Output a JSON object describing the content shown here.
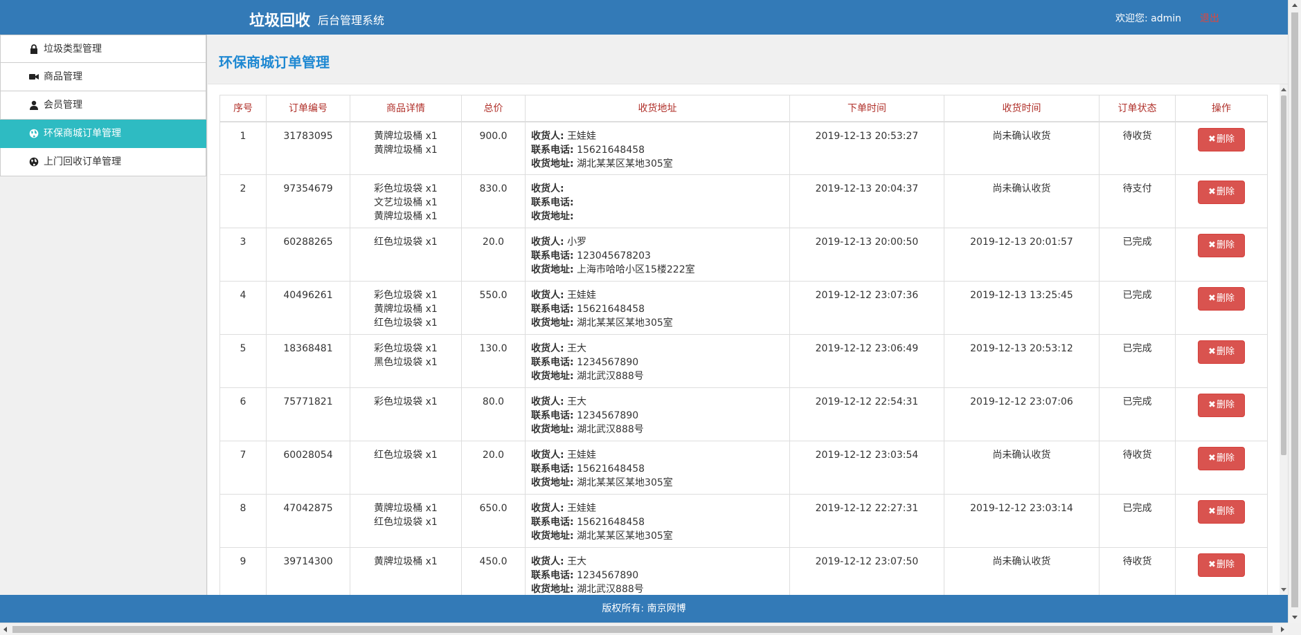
{
  "header": {
    "brand": "垃圾回收",
    "subtitle": "后台管理系统",
    "welcome": "欢迎您: admin",
    "logout": "退出"
  },
  "sidebar": {
    "items": [
      {
        "label": "垃圾类型管理",
        "icon": "lock-icon",
        "active": false
      },
      {
        "label": "商品管理",
        "icon": "video-camera-icon",
        "active": false
      },
      {
        "label": "会员管理",
        "icon": "user-icon",
        "active": false
      },
      {
        "label": "环保商城订单管理",
        "icon": "globe-icon",
        "active": true
      },
      {
        "label": "上门回收订单管理",
        "icon": "globe-icon",
        "active": false
      }
    ]
  },
  "main": {
    "title": "环保商城订单管理",
    "columns": [
      "序号",
      "订单编号",
      "商品详情",
      "总价",
      "收货地址",
      "下单时间",
      "收货时间",
      "订单状态",
      "操作"
    ],
    "address_labels": {
      "receiver": "收货人:",
      "phone": "联系电话:",
      "address": "收货地址:"
    },
    "delete_label": "删除",
    "rows": [
      {
        "index": "1",
        "order_no": "31783095",
        "items": [
          "黄牌垃圾桶 x1",
          "黄牌垃圾桶 x1"
        ],
        "total": "900.0",
        "receiver": "王娃娃",
        "phone": "15621648458",
        "address": "湖北某某区某地305室",
        "order_time": "2019-12-13 20:53:27",
        "receive_time": "尚未确认收货",
        "status": "待收货"
      },
      {
        "index": "2",
        "order_no": "97354679",
        "items": [
          "彩色垃圾袋 x1",
          "文艺垃圾桶 x1",
          "黄牌垃圾桶 x1"
        ],
        "total": "830.0",
        "receiver": "",
        "phone": "",
        "address": "",
        "order_time": "2019-12-13 20:04:37",
        "receive_time": "尚未确认收货",
        "status": "待支付"
      },
      {
        "index": "3",
        "order_no": "60288265",
        "items": [
          "红色垃圾袋 x1"
        ],
        "total": "20.0",
        "receiver": "小罗",
        "phone": "123045678203",
        "address": "上海市哈哈小区15楼222室",
        "order_time": "2019-12-13 20:00:50",
        "receive_time": "2019-12-13 20:01:57",
        "status": "已完成"
      },
      {
        "index": "4",
        "order_no": "40496261",
        "items": [
          "彩色垃圾袋 x1",
          "黄牌垃圾桶 x1",
          "红色垃圾袋 x1"
        ],
        "total": "550.0",
        "receiver": "王娃娃",
        "phone": "15621648458",
        "address": "湖北某某区某地305室",
        "order_time": "2019-12-12 23:07:36",
        "receive_time": "2019-12-13 13:25:45",
        "status": "已完成"
      },
      {
        "index": "5",
        "order_no": "18368481",
        "items": [
          "彩色垃圾袋 x1",
          "黑色垃圾袋 x1"
        ],
        "total": "130.0",
        "receiver": "王大",
        "phone": "1234567890",
        "address": "湖北武汉888号",
        "order_time": "2019-12-12 23:06:49",
        "receive_time": "2019-12-13 20:53:12",
        "status": "已完成"
      },
      {
        "index": "6",
        "order_no": "75771821",
        "items": [
          "彩色垃圾袋 x1"
        ],
        "total": "80.0",
        "receiver": "王大",
        "phone": "1234567890",
        "address": "湖北武汉888号",
        "order_time": "2019-12-12 22:54:31",
        "receive_time": "2019-12-12 23:07:06",
        "status": "已完成"
      },
      {
        "index": "7",
        "order_no": "60028054",
        "items": [
          "红色垃圾袋 x1"
        ],
        "total": "20.0",
        "receiver": "王娃娃",
        "phone": "15621648458",
        "address": "湖北某某区某地305室",
        "order_time": "2019-12-12 23:03:54",
        "receive_time": "尚未确认收货",
        "status": "待收货"
      },
      {
        "index": "8",
        "order_no": "47042875",
        "items": [
          "黄牌垃圾桶 x1",
          "红色垃圾袋 x1"
        ],
        "total": "650.0",
        "receiver": "王娃娃",
        "phone": "15621648458",
        "address": "湖北某某区某地305室",
        "order_time": "2019-12-12 22:27:31",
        "receive_time": "2019-12-12 23:03:14",
        "status": "已完成"
      },
      {
        "index": "9",
        "order_no": "39714300",
        "items": [
          "黄牌垃圾桶 x1"
        ],
        "total": "450.0",
        "receiver": "王大",
        "phone": "1234567890",
        "address": "湖北武汉888号",
        "order_time": "2019-12-12 23:07:50",
        "receive_time": "尚未确认收货",
        "status": "待收货"
      }
    ]
  },
  "footer": {
    "text": "版权所有: 南京网博"
  },
  "colors": {
    "header_bg": "#337ab7",
    "active_nav": "#2ebbc2",
    "title": "#1e88d2",
    "column_header": "#b0302a",
    "delete_button": "#d9534f",
    "logout": "#e0463c"
  }
}
